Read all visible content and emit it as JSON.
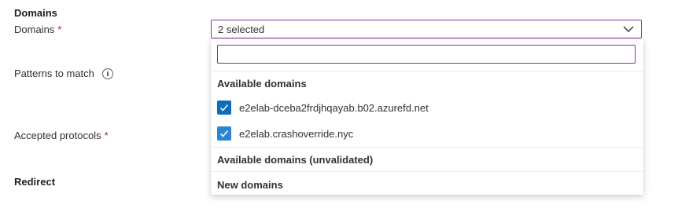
{
  "domains_section": {
    "title": "Domains",
    "field_label": "Domains",
    "required_marker": "*",
    "combo_value": "2 selected"
  },
  "patterns": {
    "label": "Patterns to match",
    "info_icon": "info-icon"
  },
  "protocols": {
    "label": "Accepted protocols",
    "required_marker": "*"
  },
  "redirect": {
    "title": "Redirect"
  },
  "dropdown": {
    "search_value": "",
    "groups": [
      {
        "header": "Available domains",
        "options": [
          {
            "label": "e2elab-dceba2frdjhqayab.b02.azurefd.net",
            "checked": true
          },
          {
            "label": "e2elab.crashoverride.nyc",
            "checked": true
          }
        ]
      },
      {
        "header": "Available domains (unvalidated)",
        "options": []
      },
      {
        "header": "New domains",
        "options": []
      }
    ]
  },
  "colors": {
    "focus_border": "#8a2da5",
    "checkbox_fill": "#0f6cbd",
    "required": "#a4262c"
  }
}
